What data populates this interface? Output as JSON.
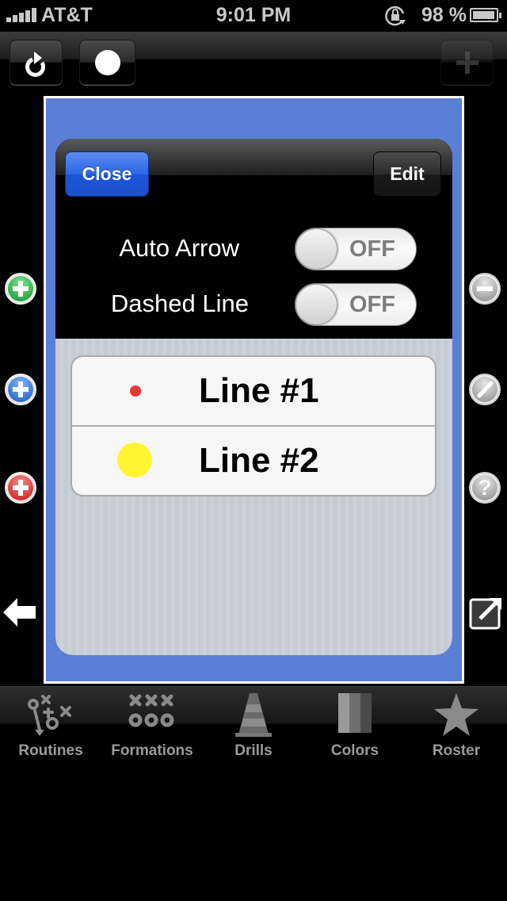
{
  "status_bar": {
    "carrier": "AT&T",
    "time": "9:01 PM",
    "battery_percent": "98 %",
    "battery_level": 0.98,
    "signal_bars": 5,
    "icons": [
      "signal-bars-icon",
      "rotation-lock-icon",
      "battery-icon"
    ]
  },
  "toolbar": {
    "left_buttons": [
      {
        "name": "refresh-button",
        "icon": "refresh-icon"
      },
      {
        "name": "circle-button",
        "icon": "white-circle-icon"
      }
    ],
    "right_button": {
      "name": "add-button",
      "icon": "plus-icon",
      "enabled": false
    }
  },
  "side_controls": {
    "left": [
      {
        "name": "add-green-button",
        "icon": "plus-green-icon",
        "color": "#28a745"
      },
      {
        "name": "add-blue-button",
        "icon": "plus-blue-icon",
        "color": "#2f6fd1"
      },
      {
        "name": "add-red-button",
        "icon": "plus-red-icon",
        "color": "#d23232"
      },
      {
        "name": "back-arrow-button",
        "icon": "left-arrow-icon"
      }
    ],
    "right": [
      {
        "name": "remove-button",
        "icon": "minus-icon"
      },
      {
        "name": "draw-line-button",
        "icon": "line-icon"
      },
      {
        "name": "help-button",
        "icon": "question-icon"
      },
      {
        "name": "share-button",
        "icon": "export-icon"
      }
    ]
  },
  "frame": {
    "background_color": "#5a7fd6"
  },
  "popover": {
    "close_label": "Close",
    "edit_label": "Edit",
    "options": [
      {
        "label": "Auto Arrow",
        "value": "OFF",
        "on": false
      },
      {
        "label": "Dashed Line",
        "value": "OFF",
        "on": false
      }
    ],
    "lines": [
      {
        "label": "Line #1",
        "color": "#ee3333",
        "dot_size": "small"
      },
      {
        "label": "Line #2",
        "color": "#fff533",
        "dot_size": "large"
      }
    ]
  },
  "tab_bar": {
    "tabs": [
      {
        "label": "Routines",
        "icon": "play-diagram-icon"
      },
      {
        "label": "Formations",
        "icon": "formation-xo-icon"
      },
      {
        "label": "Drills",
        "icon": "traffic-cone-icon"
      },
      {
        "label": "Colors",
        "icon": "color-swatch-icon"
      },
      {
        "label": "Roster",
        "icon": "star-icon"
      }
    ]
  }
}
